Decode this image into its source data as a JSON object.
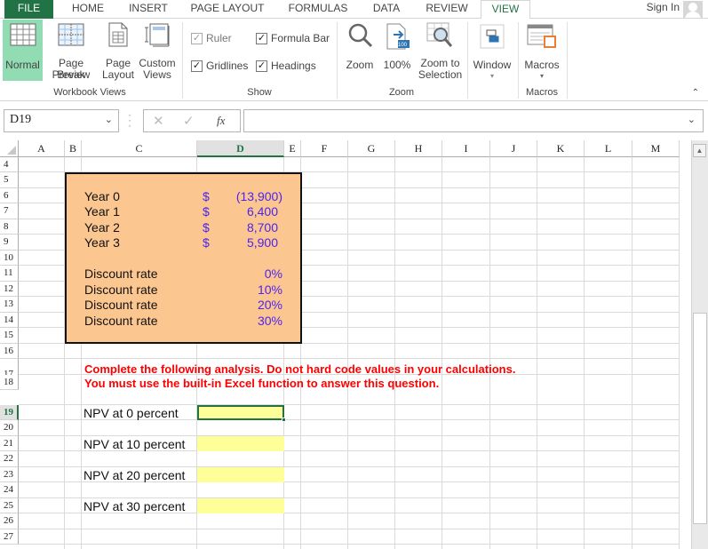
{
  "tabs": {
    "file": "FILE",
    "items": [
      "HOME",
      "INSERT",
      "PAGE LAYOUT",
      "FORMULAS",
      "DATA",
      "REVIEW",
      "VIEW"
    ],
    "active": "VIEW",
    "sign_in": "Sign In"
  },
  "ribbon": {
    "workbook_views": {
      "label": "Workbook Views",
      "normal": "Normal",
      "page_break_1": "Page Break",
      "page_break_2": "Preview",
      "page_layout_1": "Page",
      "page_layout_2": "Layout",
      "custom_views_1": "Custom",
      "custom_views_2": "Views"
    },
    "show": {
      "label": "Show",
      "ruler": {
        "label": "Ruler",
        "checked": true,
        "enabled": false
      },
      "formula_bar": {
        "label": "Formula Bar",
        "checked": true
      },
      "gridlines": {
        "label": "Gridlines",
        "checked": true
      },
      "headings": {
        "label": "Headings",
        "checked": true
      }
    },
    "zoom": {
      "label": "Zoom",
      "zoom": "Zoom",
      "hundred": "100%",
      "hundred_badge": "100",
      "zoom_sel_1": "Zoom to",
      "zoom_sel_2": "Selection"
    },
    "window": {
      "label": "Window"
    },
    "macros": {
      "label": "Macros",
      "group_label": "Macros"
    },
    "collapse_glyph": "^"
  },
  "formula_bar": {
    "name_box": "D19",
    "cancel_glyph": "✕",
    "enter_glyph": "✓",
    "fx_glyph": "fx",
    "formula": ""
  },
  "sheet": {
    "columns": [
      "A",
      "B",
      "C",
      "D",
      "E",
      "F",
      "G",
      "H",
      "I",
      "J",
      "K",
      "L",
      "M"
    ],
    "selected_column": "D",
    "rows": [
      "4",
      "5",
      "6",
      "7",
      "8",
      "9",
      "10",
      "11",
      "12",
      "13",
      "14",
      "15",
      "16",
      "17",
      "18",
      "19",
      "20",
      "21",
      "22",
      "23",
      "24",
      "25",
      "26",
      "27"
    ],
    "selected_row": "19",
    "cash_flows": [
      {
        "label": "Year 0",
        "currency": "$",
        "value": "(13,900)"
      },
      {
        "label": "Year 1",
        "currency": "$",
        "value": "6,400"
      },
      {
        "label": "Year 2",
        "currency": "$",
        "value": "8,700"
      },
      {
        "label": "Year 3",
        "currency": "$",
        "value": "5,900"
      }
    ],
    "discount_rates": [
      {
        "label": "Discount rate",
        "value": "0%"
      },
      {
        "label": "Discount rate",
        "value": "10%"
      },
      {
        "label": "Discount rate",
        "value": "20%"
      },
      {
        "label": "Discount rate",
        "value": "30%"
      }
    ],
    "instruction_line1": "Complete the following analysis. Do not hard code values in your calculations.",
    "instruction_line2": "You must use the built-in Excel function to answer this question.",
    "npv_rows": [
      {
        "label": "NPV at 0 percent",
        "value": ""
      },
      {
        "label": "NPV at 10 percent",
        "value": ""
      },
      {
        "label": "NPV at 20 percent",
        "value": ""
      },
      {
        "label": "NPV at 30 percent",
        "value": ""
      }
    ]
  },
  "colors": {
    "excel_green": "#217346",
    "orange_fill": "#fcc690",
    "input_yellow": "#ffff99",
    "value_blue": "#4b24f0",
    "instruction_red": "#ff0000"
  }
}
